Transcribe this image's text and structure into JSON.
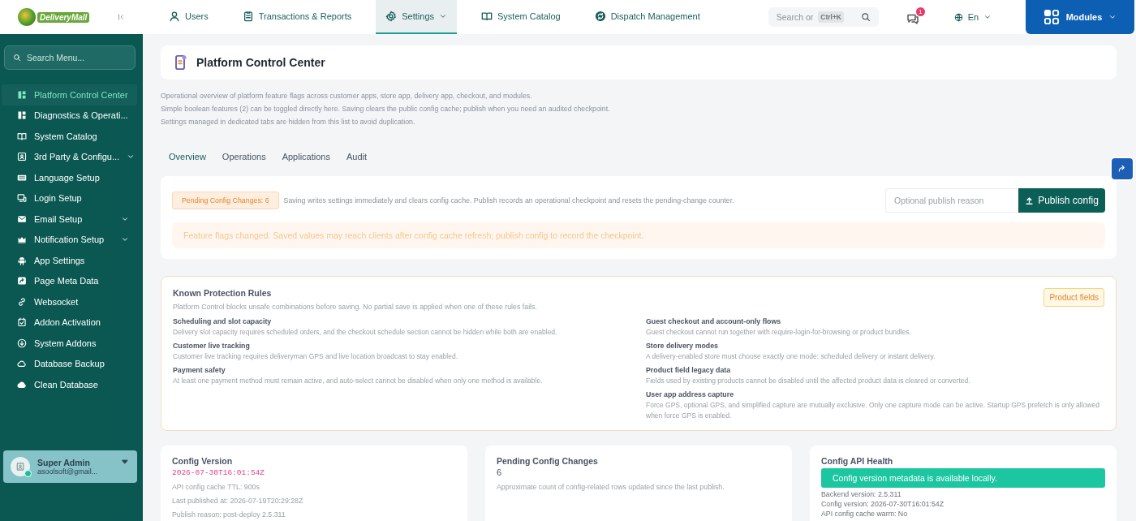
{
  "brand": {
    "name": "DeliveryMall"
  },
  "topnav": {
    "items": [
      {
        "label": "Users",
        "selected": false,
        "dropdown": false
      },
      {
        "label": "Transactions & Reports",
        "selected": false,
        "dropdown": false
      },
      {
        "label": "Settings",
        "selected": true,
        "dropdown": true
      },
      {
        "label": "System Catalog",
        "selected": false,
        "dropdown": false
      },
      {
        "label": "Dispatch Management",
        "selected": false,
        "dropdown": false
      }
    ],
    "search": {
      "placeholder": "Search or",
      "shortcut": "Ctrl+K"
    },
    "messages_badge": "1",
    "language": "En",
    "modules_button": "Modules"
  },
  "sidebar": {
    "search": {
      "placeholder": "Search Menu..."
    },
    "items": [
      {
        "label": "Platform Control Center",
        "selected": true,
        "expandable": false
      },
      {
        "label": "Diagnostics & Operati...",
        "selected": false,
        "expandable": false
      },
      {
        "label": "System Catalog",
        "selected": false,
        "expandable": false
      },
      {
        "label": "3rd Party & Configu...",
        "selected": false,
        "expandable": true
      },
      {
        "label": "Language Setup",
        "selected": false,
        "expandable": false
      },
      {
        "label": "Login Setup",
        "selected": false,
        "expandable": false
      },
      {
        "label": "Email Setup",
        "selected": false,
        "expandable": true
      },
      {
        "label": "Notification Setup",
        "selected": false,
        "expandable": true
      },
      {
        "label": "App Settings",
        "selected": false,
        "expandable": false
      },
      {
        "label": "Page Meta Data",
        "selected": false,
        "expandable": false
      },
      {
        "label": "Websocket",
        "selected": false,
        "expandable": false
      },
      {
        "label": "Addon Activation",
        "selected": false,
        "expandable": false
      },
      {
        "label": "System Addons",
        "selected": false,
        "expandable": false
      },
      {
        "label": "Database Backup",
        "selected": false,
        "expandable": false
      },
      {
        "label": "Clean Database",
        "selected": false,
        "expandable": false
      }
    ],
    "user": {
      "name": "Super Admin",
      "email": "asoolsoft@gmail...",
      "online": true
    }
  },
  "page": {
    "title": "Platform Control Center",
    "description": [
      "Operational overview of platform feature flags across customer apps, store app, delivery app, checkout, and modules.",
      "Simple boolean features (2) can be toggled directly here. Saving clears the public config cache; publish when you need an audited checkpoint.",
      "Settings managed in dedicated tabs are hidden from this list to avoid duplication."
    ],
    "tabs": [
      {
        "label": "Overview",
        "selected": true
      },
      {
        "label": "Operations",
        "selected": false
      },
      {
        "label": "Applications",
        "selected": false
      },
      {
        "label": "Audit",
        "selected": false
      }
    ]
  },
  "publish": {
    "pending_badge": "Pending Config Changes: 6",
    "note": "Saving writes settings immediately and clears config cache. Publish records an operational checkpoint and resets the pending-change counter.",
    "reason": {
      "placeholder": "Optional publish reason"
    },
    "button": "Publish config",
    "warning": "Feature flags changed. Saved values may reach clients after config cache refresh; publish config to record the checkpoint."
  },
  "rules": {
    "title": "Known Protection Rules",
    "subtitle": "Platform Control blocks unsafe combinations before saving. No partial save is applied when one of these rules fails.",
    "badge": "Product fields",
    "left": [
      {
        "title": "Scheduling and slot capacity",
        "text": "Delivery slot capacity requires scheduled orders, and the checkout schedule section cannot be hidden while both are enabled."
      },
      {
        "title": "Customer live tracking",
        "text": "Customer live tracking requires deliveryman GPS and live location broadcast to stay enabled."
      },
      {
        "title": "Payment safety",
        "text": "At least one payment method must remain active, and auto-select cannot be disabled when only one method is available."
      }
    ],
    "right": [
      {
        "title": "Guest checkout and account-only flows",
        "text": "Guest checkout cannot run together with require-login-for-browsing or product bundles."
      },
      {
        "title": "Store delivery modes",
        "text": "A delivery-enabled store must choose exactly one mode: scheduled delivery or instant delivery."
      },
      {
        "title": "Product field legacy data",
        "text": "Fields used by existing products cannot be disabled until the affected product data is cleared or converted."
      },
      {
        "title": "User app address capture",
        "text": "Force GPS, optional GPS, and simplified capture are mutually exclusive. Only one capture mode can be active. Startup GPS prefetch is only allowed when force GPS is enabled."
      }
    ]
  },
  "cards": [
    {
      "kind": "version",
      "title": "Config Version",
      "value": "2026-07-30T16:01:54Z",
      "lines": [
        "API config cache TTL: 900s",
        "Last published at: 2026-07-19T20:29:28Z",
        "Publish reason: post-deploy 2.5.311"
      ]
    },
    {
      "kind": "count",
      "title": "Pending Config Changes",
      "value": "6",
      "lines": [
        "Approximate count of config-related rows updated since the last publish."
      ]
    },
    {
      "kind": "health",
      "title": "Config API Health",
      "value": "Config version metadata is available locally.",
      "lines": [
        "Backend version: 2.5.311",
        "Config version: 2026-07-30T16:01:54Z",
        "API config cache warm: No"
      ]
    }
  ]
}
